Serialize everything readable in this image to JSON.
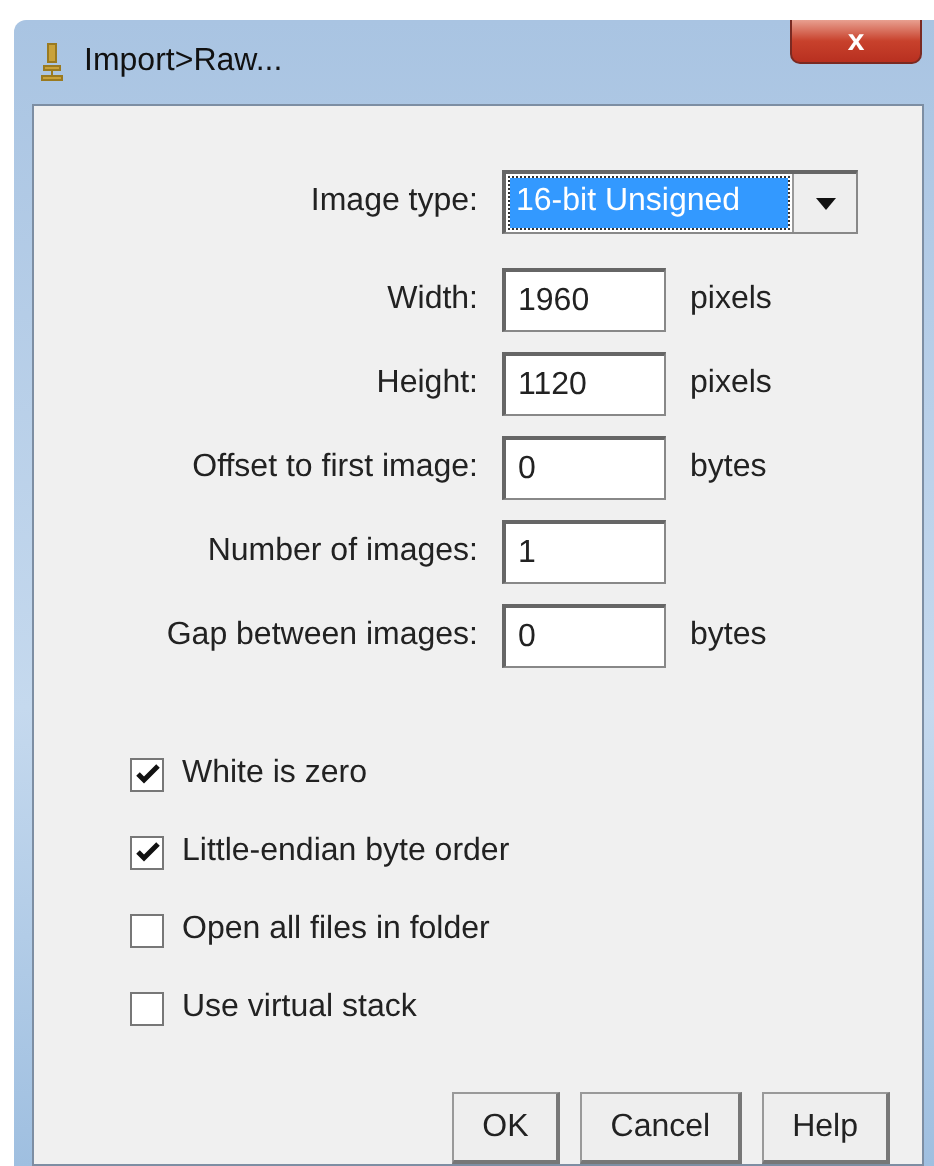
{
  "window": {
    "title": "Import>Raw...",
    "close": "x"
  },
  "image_type": {
    "label": "Image type:",
    "value": "16-bit Unsigned",
    "focused": true
  },
  "fields": [
    {
      "label": "Width:",
      "value": "1960",
      "unit": "pixels"
    },
    {
      "label": "Height:",
      "value": "1120",
      "unit": "pixels"
    },
    {
      "label": "Offset to first image:",
      "value": "0",
      "unit": "bytes"
    },
    {
      "label": "Number of images:",
      "value": "1"
    },
    {
      "label": "Gap between images:",
      "value": "0",
      "unit": "bytes"
    }
  ],
  "options": [
    {
      "label": "White is zero",
      "checked": true
    },
    {
      "label": "Little-endian byte order",
      "checked": true
    },
    {
      "label": "Open all files in folder",
      "checked": false
    },
    {
      "label": "Use virtual stack",
      "checked": false
    }
  ],
  "buttons": [
    "OK",
    "Cancel",
    "Help"
  ]
}
